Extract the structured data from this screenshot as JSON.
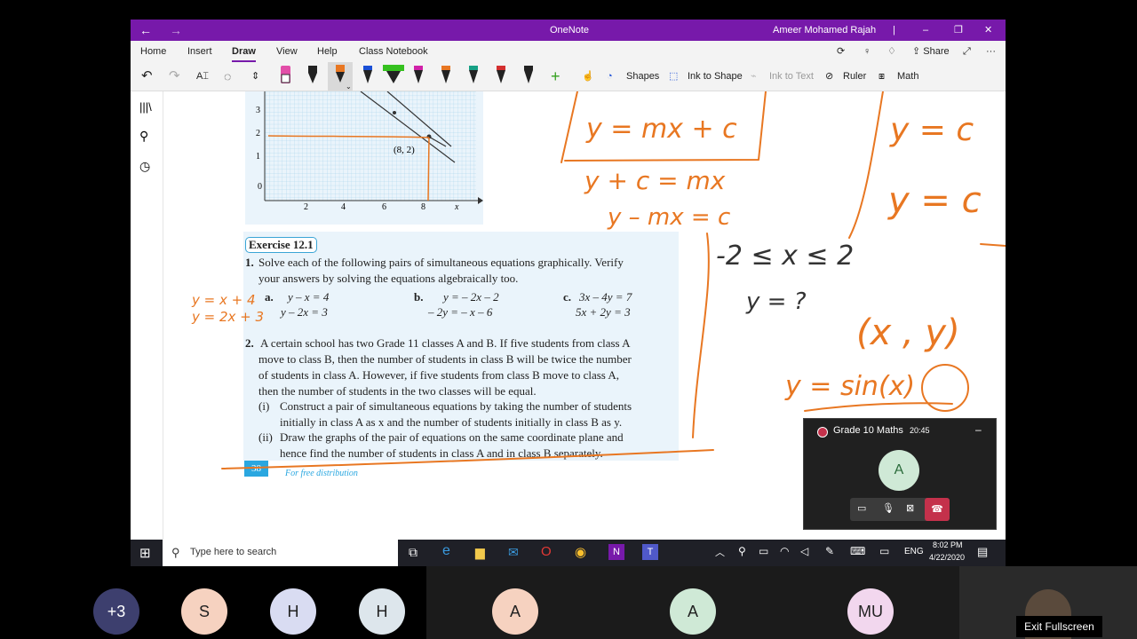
{
  "window": {
    "title": "OneNote",
    "user": "Ameer Mohamed Rajah"
  },
  "menu": [
    "Home",
    "Insert",
    "Draw",
    "View",
    "Help",
    "Class Notebook"
  ],
  "ribbon": {
    "share": "Share",
    "shapes": "Shapes",
    "ink_to_shape": "Ink to Shape",
    "ink_to_text": "Ink to Text",
    "ruler": "Ruler",
    "math": "Math"
  },
  "graph": {
    "point": "(8, 2)",
    "x_ticks": [
      "0",
      "2",
      "4",
      "6",
      "8"
    ],
    "y_ticks": [
      "1",
      "2",
      "3"
    ],
    "x_label": "x"
  },
  "textbook": {
    "exercise_title": "Exercise 12.1",
    "q1_num": "1.",
    "q1_text_1": "Solve each of the following pairs of simultaneous equations graphically. Verify",
    "q1_text_2": "your answers by solving the equations algebraically too.",
    "a_label": "a.",
    "a1": "y – x = 4",
    "a2": "y – 2x = 3",
    "b_label": "b.",
    "b1": "y = – 2x – 2",
    "b2": "– 2y = – x – 6",
    "c_label": "c.",
    "c1": "3x – 4y = 7",
    "c2": "5x + 2y = 3",
    "q2_num": "2.",
    "q2_lines": [
      "A certain school has two Grade 11 classes A and B. If five students from class A",
      "move to class B, then the number of students in class B will be twice the number",
      "of students in class A. However, if five students from class B move to class A,",
      "then the number of students in the two classes will be equal."
    ],
    "q2_i_label": "(i)",
    "q2_i_1": "Construct a pair of simultaneous equations by taking the number of students",
    "q2_i_2": "initially in class A as x and the number of students initially in class B as y.",
    "q2_ii_label": "(ii)",
    "q2_ii_1": "Draw the graphs of the pair of equations on the same coordinate plane and",
    "q2_ii_2": "hence find the number of students in class A and in class B separately.",
    "page_number": "38",
    "footer": "For free distribution"
  },
  "ink": {
    "eq1": "y = x + 4",
    "eq2": "y = 2x + 3",
    "line1": "y = mx + c",
    "line2": "y + c = mx",
    "line3": "y – mx = c",
    "inequality": "-2 ≤ x ≤ 2",
    "yq": "y = ?",
    "right1": "y = c",
    "right2": "y = c",
    "pair": "(x , y)",
    "sin": "y = sin(x)"
  },
  "taskbar": {
    "search_placeholder": "Type here to search",
    "lang": "ENG",
    "time": "8:02 PM",
    "date": "4/22/2020"
  },
  "meeting": {
    "title": "Grade 10 Maths",
    "timer": "20:45",
    "avatar": "A"
  },
  "participants": [
    "+3",
    "S",
    "H",
    "H",
    "A",
    "A",
    "MU"
  ],
  "exit_fullscreen": "Exit Fullscreen",
  "colors": {
    "onenote_purple": "#7719aa",
    "ink_orange": "#e87722",
    "taskbar": "#1f2027",
    "hangup": "#c4314b"
  }
}
